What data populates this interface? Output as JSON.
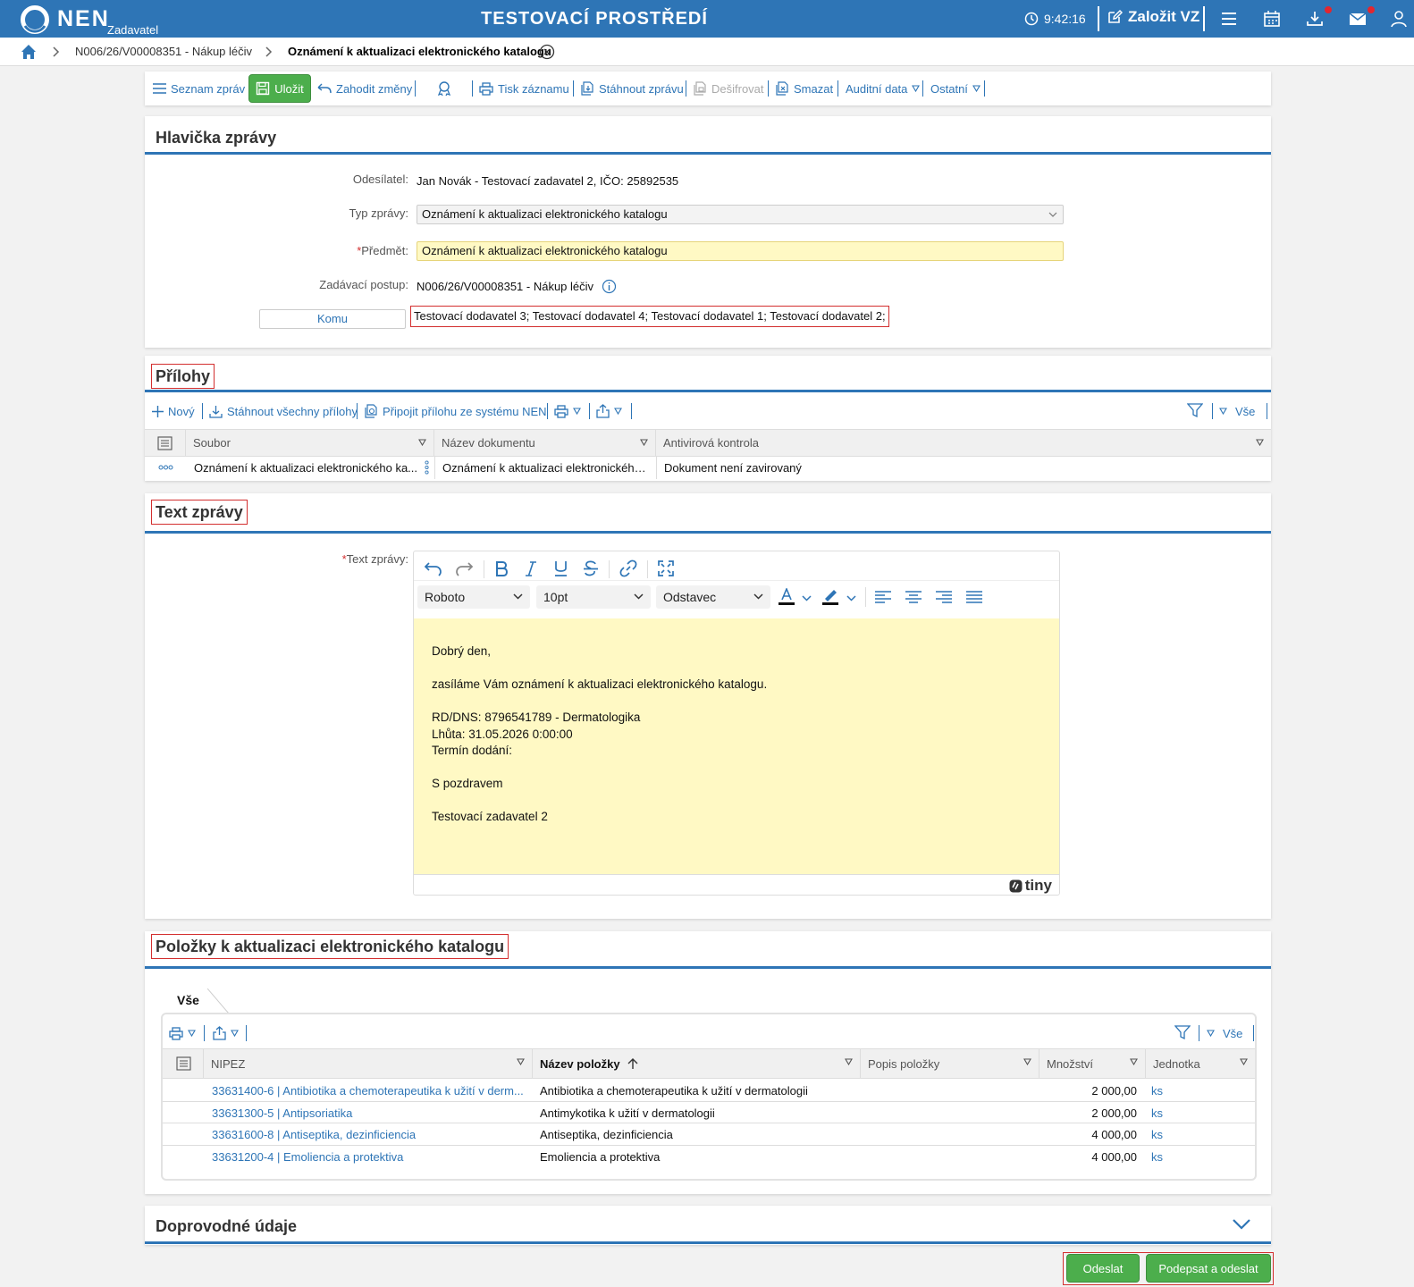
{
  "topbar": {
    "logo": "NEN",
    "logo_sub": "Zadavatel",
    "env_title": "TESTOVACÍ PROSTŘEDÍ",
    "time": "9:42:16",
    "create_label": "Založit VZ",
    "icons": [
      "clock-icon",
      "edit-icon",
      "menu-icon",
      "calendar-icon",
      "download-icon",
      "mail-icon",
      "user-icon"
    ]
  },
  "breadcrumb": {
    "items": [
      "N006/26/V00008351 - Nákup léčiv",
      "Oznámení k aktualizaci elektronického katalogu"
    ]
  },
  "toolbar": {
    "list": "Seznam zpráv",
    "save": "Uložit",
    "discard": "Zahodit změny",
    "print": "Tisk záznamu",
    "download": "Stáhnout zprávu",
    "decrypt": "Dešifrovat",
    "delete": "Smazat",
    "audit": "Auditní data",
    "other": "Ostatní"
  },
  "header": {
    "title": "Hlavička zprávy",
    "sender_label": "Odesílatel:",
    "sender": "Jan Novák - Testovací zadavatel 2, IČO: 25892535",
    "type_label": "Typ zprávy:",
    "type": "Oznámení k aktualizaci elektronického katalogu",
    "subject_label": "Předmět:",
    "subject": "Oznámení k aktualizaci elektronického katalogu",
    "procedure_label": "Zadávací postup:",
    "procedure": "N006/26/V00008351 - Nákup léčiv",
    "to_button": "Komu",
    "to_value": "Testovací dodavatel 3; Testovací dodavatel 4; Testovací dodavatel 1; Testovací dodavatel 2;"
  },
  "attachments": {
    "title": "Přílohy",
    "new": "Nový",
    "download_all": "Stáhnout všechny přílohy",
    "attach_system": "Připojit přílohu ze systému NEN",
    "filter_all": "Vše",
    "columns": [
      "Soubor",
      "Název dokumentu",
      "Antivirová kontrola"
    ],
    "rows": [
      {
        "file": "Oznámení k aktualizaci elektronického ka...",
        "name": "Oznámení k aktualizaci elektronického ...",
        "av": "Dokument není zavirovaný"
      }
    ]
  },
  "message": {
    "title": "Text zprávy",
    "label": "Text zprávy:",
    "font": "Roboto",
    "size": "10pt",
    "block": "Odstavec",
    "lines": [
      "Dobrý den,",
      "",
      "zasíláme Vám oznámení k aktualizaci elektronického katalogu.",
      "",
      "RD/DNS: 8796541789 - Dermatologika",
      "Lhůta: 31.05.2026 0:00:00",
      "Termín dodání:",
      "",
      "S pozdravem",
      "",
      "Testovací zadavatel 2"
    ],
    "brand": "tiny"
  },
  "items": {
    "title": "Položky k aktualizaci elektronického katalogu",
    "tab": "Vše",
    "filter_all": "Vše",
    "columns": [
      "NIPEZ",
      "Název položky",
      "Popis položky",
      "Množství",
      "Jednotka"
    ],
    "rows": [
      {
        "nipez": "33631400-6 | Antibiotika a chemoterapeutika k užití v derm...",
        "name": "Antibiotika a chemoterapeutika k užití v dermatologii",
        "desc": "",
        "qty": "2 000,00",
        "unit": "ks"
      },
      {
        "nipez": "33631300-5 | Antipsoriatika",
        "name": "Antimykotika k užití v dermatologii",
        "desc": "",
        "qty": "2 000,00",
        "unit": "ks"
      },
      {
        "nipez": "33631600-8 | Antiseptika, dezinficiencia",
        "name": "Antiseptika, dezinficiencia",
        "desc": "",
        "qty": "4 000,00",
        "unit": "ks"
      },
      {
        "nipez": "33631200-4 | Emoliencia a protektiva",
        "name": "Emoliencia a protektiva",
        "desc": "",
        "qty": "4 000,00",
        "unit": "ks"
      }
    ]
  },
  "accompanying": {
    "title": "Doprovodné údaje"
  },
  "actions": {
    "send": "Odeslat",
    "sign_send": "Podepsat a odeslat"
  },
  "colors": {
    "brand_blue": "#2e75b6",
    "green": "#4cae4c",
    "highlight_red": "#d32f2f",
    "editor_yellow": "#fff9c4"
  }
}
